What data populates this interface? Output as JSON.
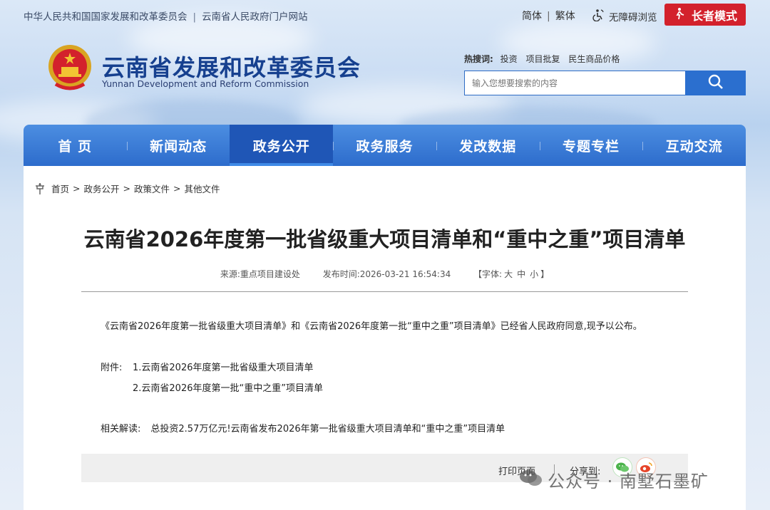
{
  "topbar": {
    "links": [
      "中华人民共和国国家发展和改革委员会",
      "云南省人民政府门户网站"
    ],
    "lang_simplified": "简体",
    "lang_traditional": "繁体",
    "accessibility": "无障碍浏览",
    "elder_mode": "长者模式"
  },
  "header": {
    "title": "云南省发展和改革委员会",
    "subtitle": "Yunnan Development and Reform Commission",
    "hot_label": "热搜词:",
    "hot_words": [
      "投资",
      "项目批复",
      "民生商品价格"
    ],
    "search_placeholder": "输入您想要搜索的内容"
  },
  "nav": {
    "items": [
      "首 页",
      "新闻动态",
      "政务公开",
      "政务服务",
      "发改数据",
      "专题专栏",
      "互动交流"
    ],
    "active_index": 2
  },
  "breadcrumb": [
    "首页",
    "政务公开",
    "政策文件",
    "其他文件"
  ],
  "article": {
    "title": "云南省2026年度第一批省级重大项目清单和“重中之重”项目清单",
    "source": "来源:重点项目建设处",
    "published": "发布时间:2026-03-21 16:54:34",
    "font_size_prefix": "【字体:",
    "font_sizes": [
      "大",
      "中",
      "小"
    ],
    "font_size_suffix": "】",
    "body": "《云南省2026年度第一批省级重大项目清单》和《云南省2026年度第一批“重中之重”项目清单》已经省人民政府同意,现予以公布。",
    "attachments_label": "附件:",
    "attachments": [
      "1.云南省2026年度第一批省级重大项目清单",
      "2.云南省2026年度第一批“重中之重”项目清单"
    ],
    "related_label": "相关解读:",
    "related_link": "总投资2.57万亿元!云南省发布2026年第一批省级重大项目清单和“重中之重”项目清单",
    "print_label": "打印页面",
    "share_label": "分享到:"
  },
  "watermark": "公众号 · 南墅石墨矿",
  "colors": {
    "brand_blue": "#16408f",
    "nav_blue": "#2d6ccc",
    "elder_red": "#d3212c"
  }
}
